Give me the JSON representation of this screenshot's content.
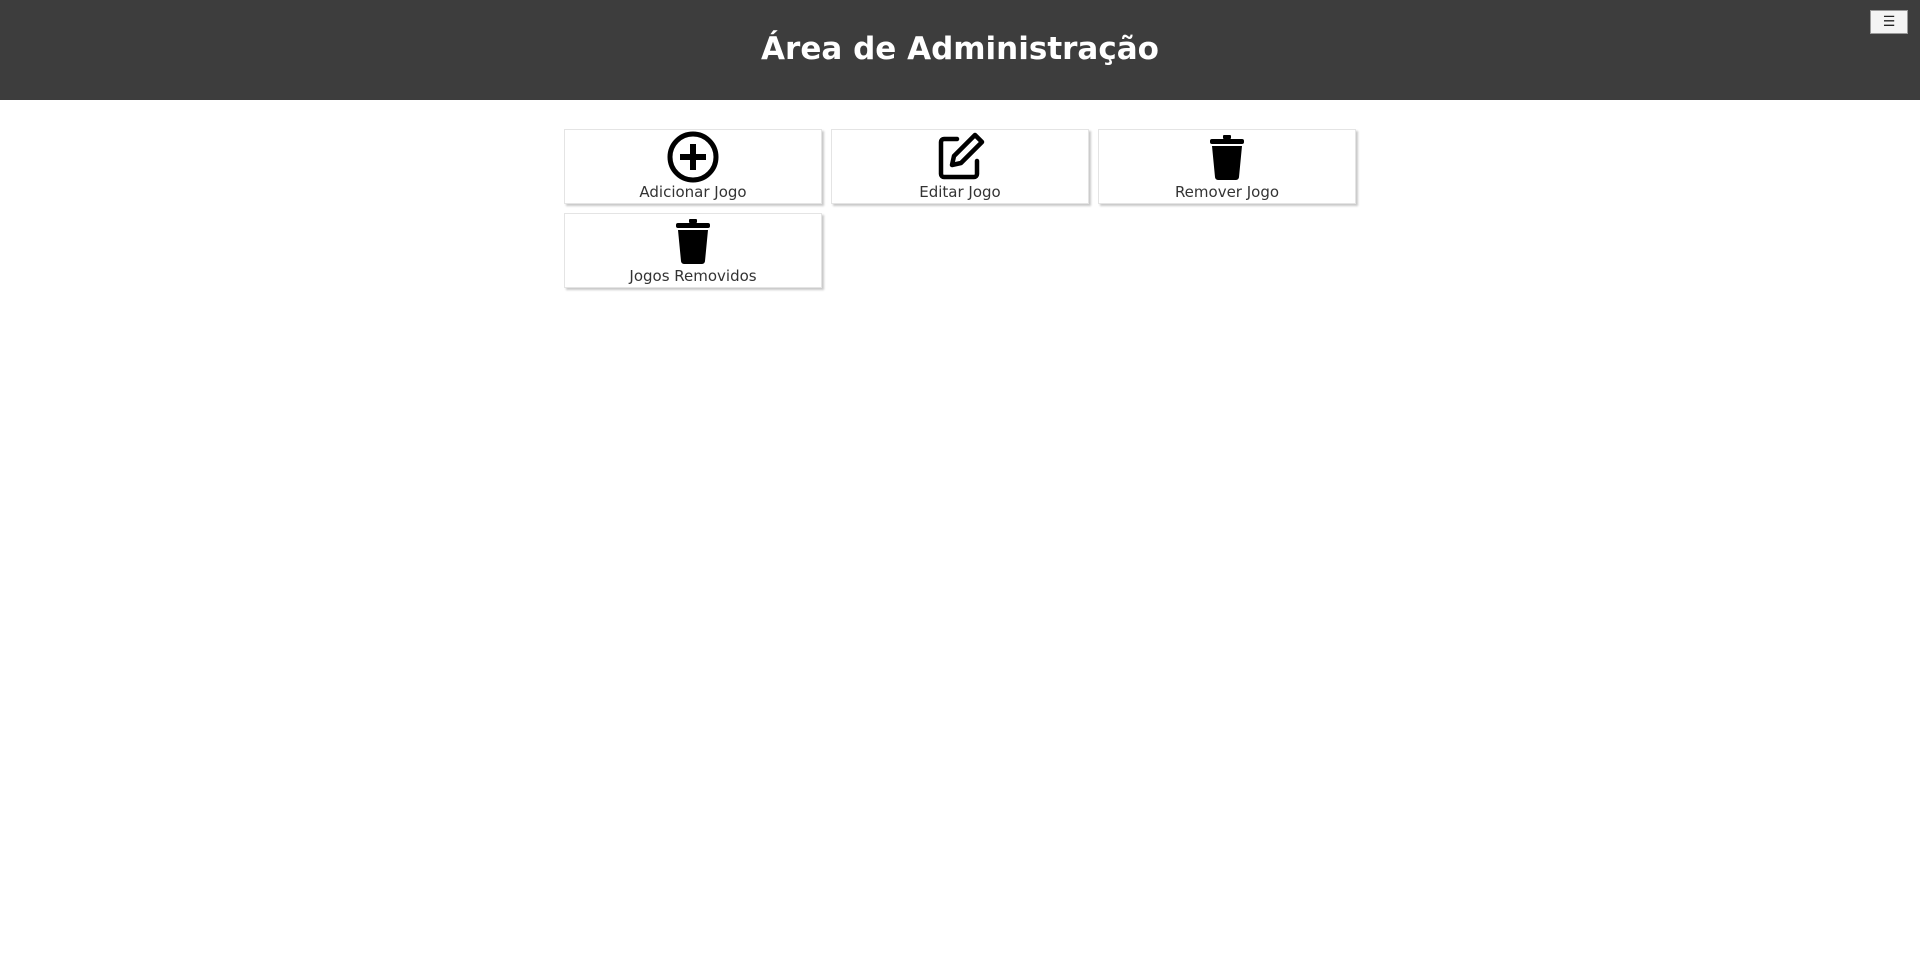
{
  "header": {
    "title": "Área de Administração",
    "menu_icon": "☰",
    "background_color": "#3d3d3d"
  },
  "menu_button": {
    "icon": "hamburger-icon"
  },
  "cards": [
    {
      "label": "Adicionar Jogo",
      "icon": "plus-circle-icon"
    },
    {
      "label": "Editar Jogo",
      "icon": "edit-icon"
    },
    {
      "label": "Remover Jogo",
      "icon": "trash-icon"
    },
    {
      "label": "Jogos Removidos",
      "icon": "trash-icon"
    }
  ]
}
